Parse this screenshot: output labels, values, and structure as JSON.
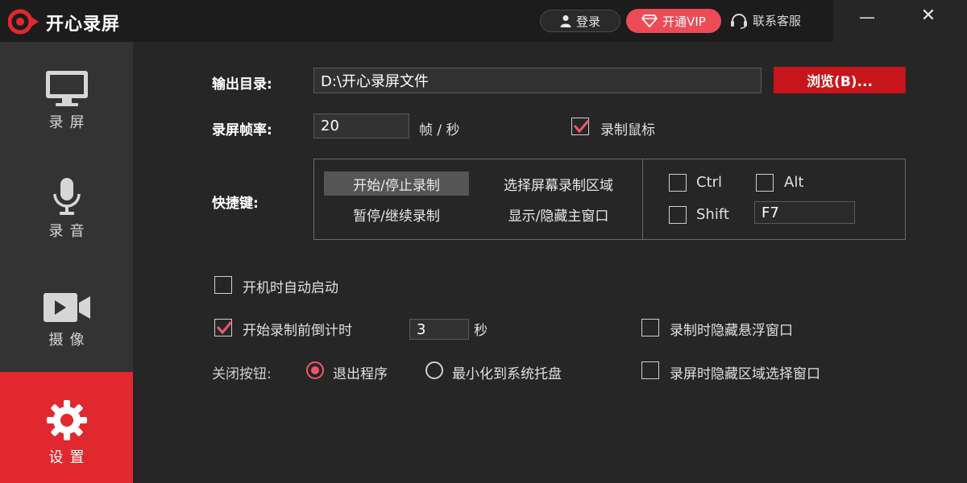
{
  "app": {
    "title": "开心录屏"
  },
  "header": {
    "login_label": "登录",
    "vip_label": "开通VIP",
    "service_label": "联系客服"
  },
  "window": {
    "minimize": "—",
    "close": "✕"
  },
  "sidebar": {
    "items": [
      {
        "label": "录屏",
        "icon": "monitor-icon"
      },
      {
        "label": "录音",
        "icon": "microphone-icon"
      },
      {
        "label": "摄像",
        "icon": "video-camera-icon"
      },
      {
        "label": "设置",
        "icon": "gear-icon",
        "active": true
      }
    ]
  },
  "settings": {
    "output_dir_label": "输出目录:",
    "output_dir_value": "D:\\开心录屏文件",
    "browse_label": "浏览(B)...",
    "fps_label": "录屏帧率:",
    "fps_value": "20",
    "fps_unit": "帧 / 秒",
    "record_mouse_label": "录制鼠标",
    "record_mouse_checked": true,
    "hotkey_label": "快捷键:",
    "hotkeys": [
      {
        "label": "开始/停止录制",
        "selected": true
      },
      {
        "label": "选择屏幕录制区域",
        "selected": false
      },
      {
        "label": "暂停/继续录制",
        "selected": false
      },
      {
        "label": "显示/隐藏主窗口",
        "selected": false
      }
    ],
    "modifiers": {
      "ctrl_label": "Ctrl",
      "alt_label": "Alt",
      "shift_label": "Shift",
      "key_value": "F7"
    },
    "autostart_label": "开机时自动启动",
    "countdown_label": "开始录制前倒计时",
    "countdown_value": "3",
    "countdown_unit": "秒",
    "hide_float_label": "录制时隐藏悬浮窗口",
    "close_btn_label": "关闭按钮:",
    "close_option_exit": "退出程序",
    "close_option_tray": "最小化到系统托盘",
    "hide_region_label": "录屏时隐藏区域选择窗口"
  },
  "colors": {
    "accent": "#e0282e",
    "vip": "#ee4b57",
    "check": "#f0576a"
  }
}
